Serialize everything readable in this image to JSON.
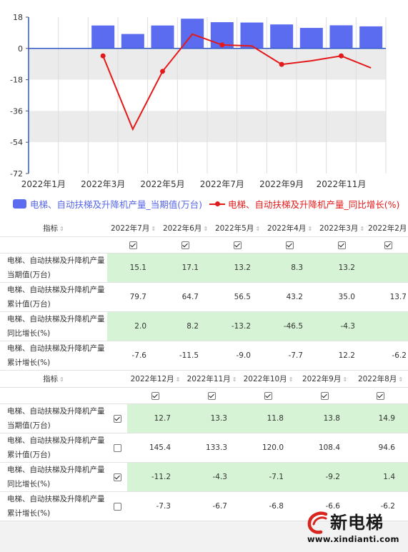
{
  "chart_data": {
    "type": "bar",
    "x_tick_labels": [
      "2022年1月",
      "2022年3月",
      "2022年5月",
      "2022年7月",
      "2022年9月",
      "2022年11月"
    ],
    "categories": [
      "2022年1月",
      "2022年2月",
      "2022年3月",
      "2022年4月",
      "2022年5月",
      "2022年6月",
      "2022年7月",
      "2022年8月",
      "2022年9月",
      "2022年10月",
      "2022年11月",
      "2022年12月"
    ],
    "ylim": [
      -72,
      18
    ],
    "yticks": [
      18,
      0,
      -18,
      -36,
      -54,
      -72
    ],
    "grid": true,
    "legend_placement": "bottom",
    "series": [
      {
        "name": "电梯、自动扶梯及升降机产量_当期值(万台)",
        "type": "bar",
        "color": "#5b6cf0",
        "values": [
          null,
          null,
          13.2,
          8.3,
          13.2,
          17.1,
          15.1,
          14.9,
          13.8,
          11.8,
          13.3,
          12.7
        ]
      },
      {
        "name": "电梯、自动扶梯及升降机产量_同比增长(%)",
        "type": "line",
        "color": "#e41a1a",
        "values": [
          null,
          null,
          -4.3,
          -46.5,
          -13.2,
          8.2,
          2.0,
          1.4,
          -9.2,
          -7.1,
          -4.3,
          -11.2
        ]
      }
    ]
  },
  "legend": {
    "bar_label": "电梯、自动扶梯及升降机产量_当期值(万台)",
    "line_label": "电梯、自动扶梯及升降机产量_同比增长(%)"
  },
  "table1": {
    "header_label": "指标",
    "columns": [
      "2022年7月",
      "2022年6月",
      "2022年5月",
      "2022年4月",
      "2022年3月",
      "2022年2月"
    ],
    "rows": [
      {
        "name_line1": "电梯、自动扶梯及升降机产量",
        "name_line2": "当期值(万台)",
        "values": [
          "15.1",
          "17.1",
          "13.2",
          "8.3",
          "13.2",
          ""
        ]
      },
      {
        "name_line1": "电梯、自动扶梯及升降机产量",
        "name_line2": "累计值(万台)",
        "values": [
          "79.7",
          "64.7",
          "56.5",
          "43.2",
          "35.0",
          "13.7"
        ]
      },
      {
        "name_line1": "电梯、自动扶梯及升降机产量",
        "name_line2": "同比增长(%)",
        "values": [
          "2.0",
          "8.2",
          "-13.2",
          "-46.5",
          "-4.3",
          ""
        ]
      },
      {
        "name_line1": "电梯、自动扶梯及升降机产量",
        "name_line2": "累计增长(%)",
        "values": [
          "-7.6",
          "-11.5",
          "-9.0",
          "-7.7",
          "12.2",
          "-6.2"
        ]
      }
    ]
  },
  "table2": {
    "header_label": "指标",
    "columns": [
      "2022年12月",
      "2022年11月",
      "2022年10月",
      "2022年9月",
      "2022年8月"
    ],
    "rows": [
      {
        "name_line1": "电梯、自动扶梯及升降机产量",
        "name_line2": "当期值(万台)",
        "checked": true,
        "values": [
          "12.7",
          "13.3",
          "11.8",
          "13.8",
          "14.9"
        ]
      },
      {
        "name_line1": "电梯、自动扶梯及升降机产量",
        "name_line2": "累计值(万台)",
        "checked": false,
        "values": [
          "145.4",
          "133.3",
          "120.0",
          "108.4",
          "94.6"
        ]
      },
      {
        "name_line1": "电梯、自动扶梯及升降机产量",
        "name_line2": "同比增长(%)",
        "checked": true,
        "values": [
          "-11.2",
          "-4.3",
          "-7.1",
          "-9.2",
          "1.4"
        ]
      },
      {
        "name_line1": "电梯、自动扶梯及升降机产量",
        "name_line2": "累计增长(%)",
        "checked": false,
        "values": [
          "-7.3",
          "-6.7",
          "-6.8",
          "-6.6",
          "-6.2"
        ]
      }
    ]
  },
  "watermark": {
    "brand": "新电梯",
    "url": "www.xindianti.com"
  }
}
